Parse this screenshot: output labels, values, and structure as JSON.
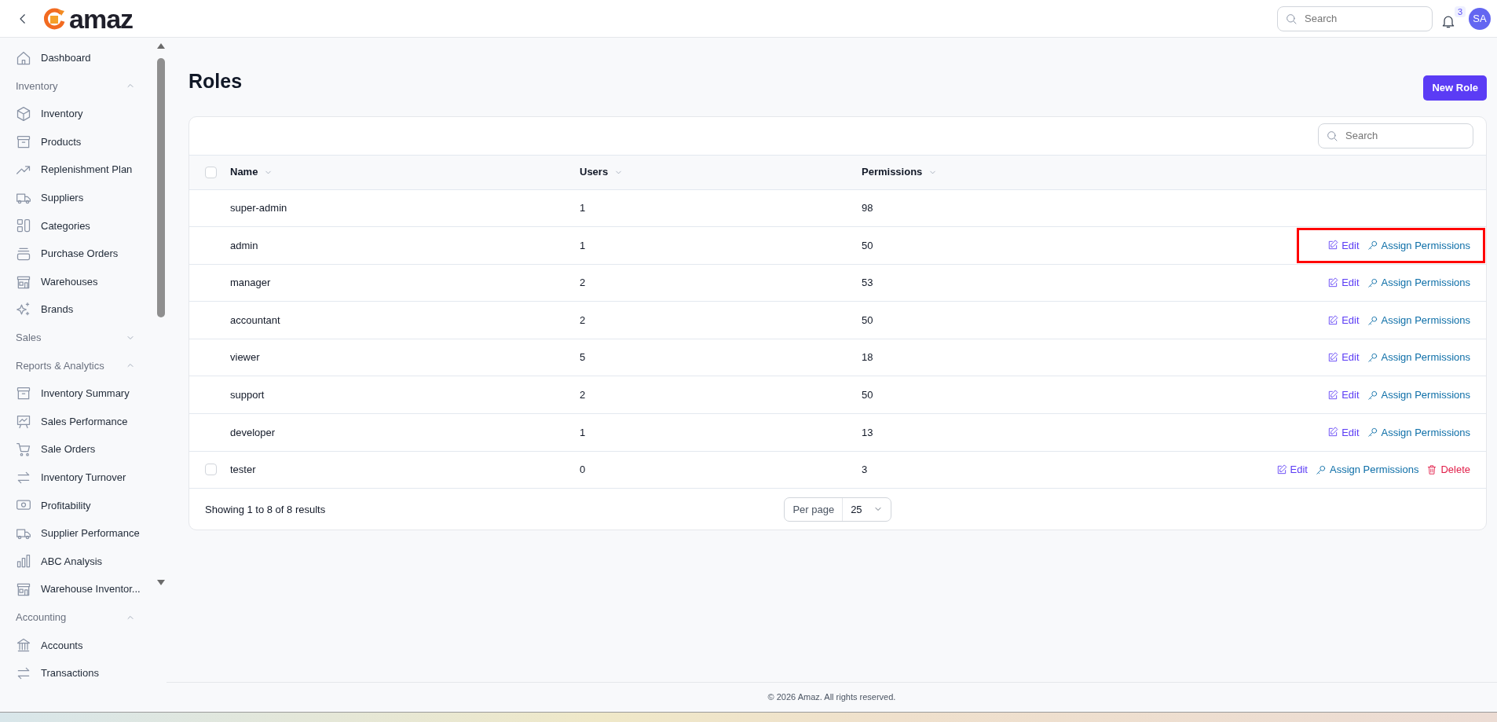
{
  "header": {
    "logo_text": "amaz",
    "search": {
      "placeholder": "Search"
    },
    "notifications": {
      "count": "3"
    },
    "avatar": {
      "initials": "SA"
    }
  },
  "sidebar": {
    "items": [
      {
        "kind": "link",
        "label": "Dashboard"
      },
      {
        "kind": "group",
        "label": "Inventory",
        "expanded": true,
        "children": [
          {
            "kind": "link",
            "label": "Inventory"
          },
          {
            "kind": "link",
            "label": "Products"
          },
          {
            "kind": "link",
            "label": "Replenishment Plan"
          },
          {
            "kind": "link",
            "label": "Suppliers"
          },
          {
            "kind": "link",
            "label": "Categories"
          },
          {
            "kind": "link",
            "label": "Purchase Orders"
          },
          {
            "kind": "link",
            "label": "Warehouses"
          },
          {
            "kind": "link",
            "label": "Brands"
          }
        ]
      },
      {
        "kind": "group",
        "label": "Sales",
        "expanded": false
      },
      {
        "kind": "group",
        "label": "Reports & Analytics",
        "expanded": true,
        "children": [
          {
            "kind": "link",
            "label": "Inventory Summary"
          },
          {
            "kind": "link",
            "label": "Sales Performance"
          },
          {
            "kind": "link",
            "label": "Sale Orders"
          },
          {
            "kind": "link",
            "label": "Inventory Turnover"
          },
          {
            "kind": "link",
            "label": "Profitability"
          },
          {
            "kind": "link",
            "label": "Supplier Performance"
          },
          {
            "kind": "link",
            "label": "ABC Analysis"
          },
          {
            "kind": "link",
            "label": "Warehouse Inventor..."
          }
        ]
      },
      {
        "kind": "group",
        "label": "Accounting",
        "expanded": true,
        "children": [
          {
            "kind": "link",
            "label": "Accounts"
          },
          {
            "kind": "link",
            "label": "Transactions"
          }
        ]
      }
    ]
  },
  "page": {
    "title": "Roles",
    "new_button": "New Role"
  },
  "table": {
    "search": {
      "placeholder": "Search"
    },
    "columns": [
      {
        "label": "Name"
      },
      {
        "label": "Users"
      },
      {
        "label": "Permissions"
      }
    ],
    "select_all": {
      "checked": false
    },
    "rows": [
      {
        "name": "super-admin",
        "users": "1",
        "permissions": "98",
        "selectable": false,
        "highlighted": false,
        "actions": []
      },
      {
        "name": "admin",
        "users": "1",
        "permissions": "50",
        "selectable": false,
        "highlighted": true,
        "actions": [
          {
            "kind": "edit",
            "label": "Edit"
          },
          {
            "kind": "assign",
            "label": "Assign Permissions"
          }
        ]
      },
      {
        "name": "manager",
        "users": "2",
        "permissions": "53",
        "selectable": false,
        "highlighted": false,
        "actions": [
          {
            "kind": "edit",
            "label": "Edit"
          },
          {
            "kind": "assign",
            "label": "Assign Permissions"
          }
        ]
      },
      {
        "name": "accountant",
        "users": "2",
        "permissions": "50",
        "selectable": false,
        "highlighted": false,
        "actions": [
          {
            "kind": "edit",
            "label": "Edit"
          },
          {
            "kind": "assign",
            "label": "Assign Permissions"
          }
        ]
      },
      {
        "name": "viewer",
        "users": "5",
        "permissions": "18",
        "selectable": false,
        "highlighted": false,
        "actions": [
          {
            "kind": "edit",
            "label": "Edit"
          },
          {
            "kind": "assign",
            "label": "Assign Permissions"
          }
        ]
      },
      {
        "name": "support",
        "users": "2",
        "permissions": "50",
        "selectable": false,
        "highlighted": false,
        "actions": [
          {
            "kind": "edit",
            "label": "Edit"
          },
          {
            "kind": "assign",
            "label": "Assign Permissions"
          }
        ]
      },
      {
        "name": "developer",
        "users": "1",
        "permissions": "13",
        "selectable": false,
        "highlighted": false,
        "actions": [
          {
            "kind": "edit",
            "label": "Edit"
          },
          {
            "kind": "assign",
            "label": "Assign Permissions"
          }
        ]
      },
      {
        "name": "tester",
        "users": "0",
        "permissions": "3",
        "selectable": true,
        "checked": false,
        "highlighted": false,
        "actions": [
          {
            "kind": "edit",
            "label": "Edit"
          },
          {
            "kind": "assign",
            "label": "Assign Permissions"
          },
          {
            "kind": "delete",
            "label": "Delete"
          }
        ]
      }
    ],
    "summary": "Showing 1 to 8 of 8 results",
    "per_page": {
      "label": "Per page",
      "value": "25"
    }
  },
  "footer": "© 2026 Amaz. All rights reserved."
}
